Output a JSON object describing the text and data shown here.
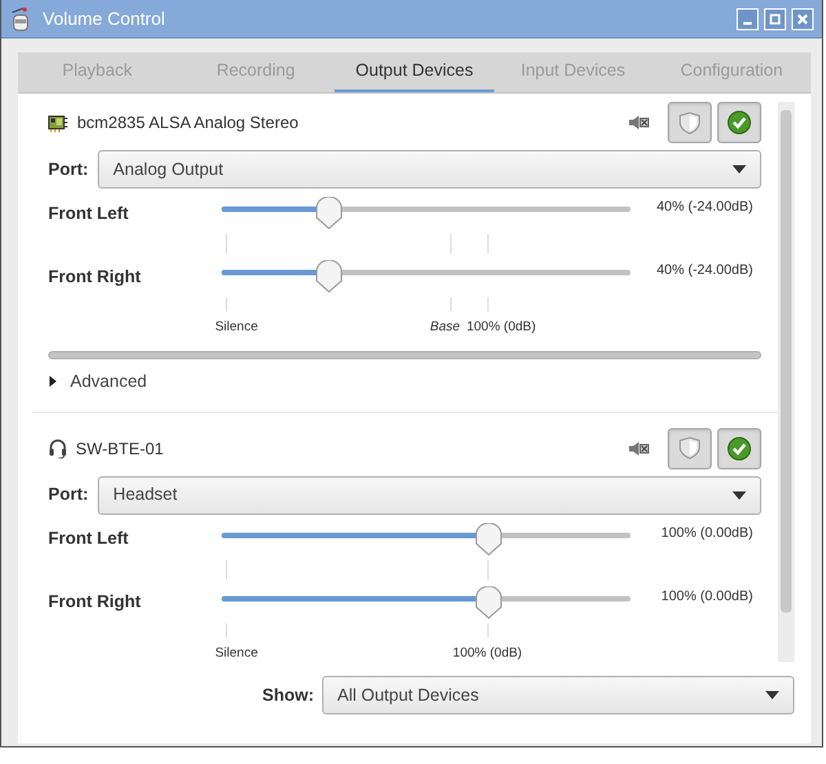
{
  "window": {
    "title": "Volume Control"
  },
  "tabs": [
    {
      "label": "Playback",
      "selected": false
    },
    {
      "label": "Recording",
      "selected": false
    },
    {
      "label": "Output Devices",
      "selected": true
    },
    {
      "label": "Input Devices",
      "selected": false
    },
    {
      "label": "Configuration",
      "selected": false
    }
  ],
  "devices": [
    {
      "kind": "card",
      "name": "bcm2835 ALSA Analog Stereo",
      "lock_channels": true,
      "default": true,
      "port": {
        "label": "Port:",
        "value": "Analog Output"
      },
      "channels": [
        {
          "name": "Front Left",
          "level": 0.263,
          "reading": "40% (-24.00dB)"
        },
        {
          "name": "Front Right",
          "level": 0.263,
          "reading": "40% (-24.00dB)"
        }
      ],
      "scale": [
        {
          "kind": "silence",
          "label": "Silence"
        },
        {
          "kind": "base",
          "label": "Base"
        },
        {
          "kind": "normal",
          "label": "100% (0dB)"
        }
      ],
      "advanced": {
        "label": "Advanced",
        "expanded": false
      }
    },
    {
      "kind": "headset",
      "name": "SW-BTE-01",
      "lock_channels": true,
      "default": true,
      "port": {
        "label": "Port:",
        "value": "Headset"
      },
      "channels": [
        {
          "name": "Front Left",
          "level": 0.653,
          "reading": "100% (0.00dB)"
        },
        {
          "name": "Front Right",
          "level": 0.653,
          "reading": "100% (0.00dB)"
        }
      ],
      "scale": [
        {
          "kind": "silence",
          "label": "Silence"
        },
        {
          "kind": "normal",
          "label": "100% (0dB)"
        }
      ]
    }
  ],
  "show": {
    "label": "Show:",
    "value": "All Output Devices"
  }
}
